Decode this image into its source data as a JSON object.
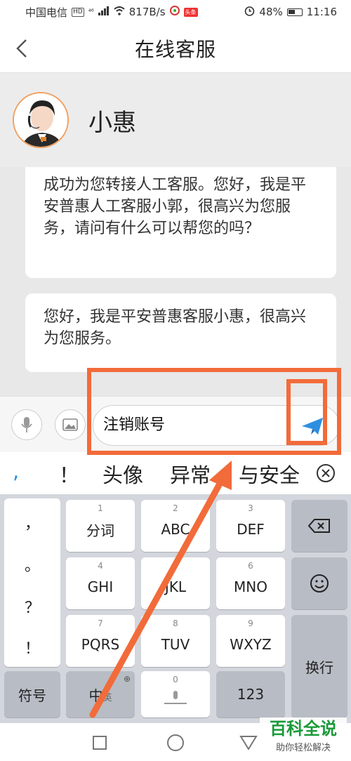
{
  "status_bar": {
    "carrier": "中国电信",
    "hd_badge": "HD",
    "network": "⁴⁶",
    "speed": "817B/s",
    "app_badge": "头条",
    "battery": "48%",
    "time": "11:16"
  },
  "header": {
    "title": "在线客服"
  },
  "agent": {
    "name": "小惠"
  },
  "messages": [
    {
      "text": "成功为您转接人工客服。您好，我是平安普惠人工客服小郭，很高兴为您服务，请问有什么可以帮您的吗？"
    },
    {
      "text": "您好，我是平安普惠客服小惠，很高兴为您服务。"
    }
  ],
  "input": {
    "value": "注销账号"
  },
  "candidates": {
    "items": [
      ",",
      "！",
      "头像",
      "异常",
      "与安全"
    ]
  },
  "keyboard": {
    "punct": [
      "，",
      "。",
      "？",
      "！"
    ],
    "keys": [
      {
        "num": "1",
        "label": "分词"
      },
      {
        "num": "2",
        "label": "ABC"
      },
      {
        "num": "3",
        "label": "DEF"
      },
      {
        "num": "4",
        "label": "GHI"
      },
      {
        "num": "5",
        "label": "JKL"
      },
      {
        "num": "6",
        "label": "MNO"
      },
      {
        "num": "7",
        "label": "PQRS"
      },
      {
        "num": "8",
        "label": "TUV"
      },
      {
        "num": "9",
        "label": "WXYZ"
      }
    ],
    "symbols_label": "符号",
    "lang_label": "中",
    "lang_sub": "英",
    "space_num": "0",
    "num_label": "123",
    "enter_label": "换行"
  },
  "watermark": {
    "title": "百科全说",
    "subtitle": "助你轻松解决"
  },
  "colors": {
    "accent": "#f26b3a",
    "send": "#2e8fe0",
    "watermark": "#1a9a3a"
  }
}
